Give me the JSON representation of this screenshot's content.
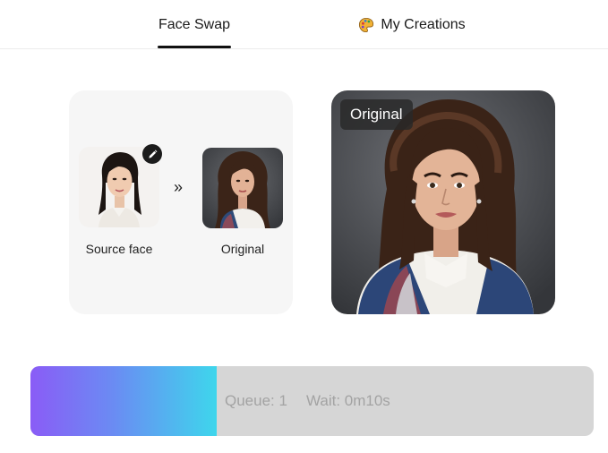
{
  "tabs": {
    "face_swap": "Face Swap",
    "my_creations": "My Creations",
    "my_creations_icon": "palette-icon"
  },
  "swap_card": {
    "source_label": "Source face",
    "original_label": "Original",
    "arrow": "»",
    "edit_icon": "pencil-icon"
  },
  "preview": {
    "badge": "Original"
  },
  "progress": {
    "fraction": 0.33,
    "queue": "Queue: 1",
    "wait": "Wait: 0m10s",
    "gradient_start": "#8a5cf6",
    "gradient_end": "#3ed6ec"
  }
}
